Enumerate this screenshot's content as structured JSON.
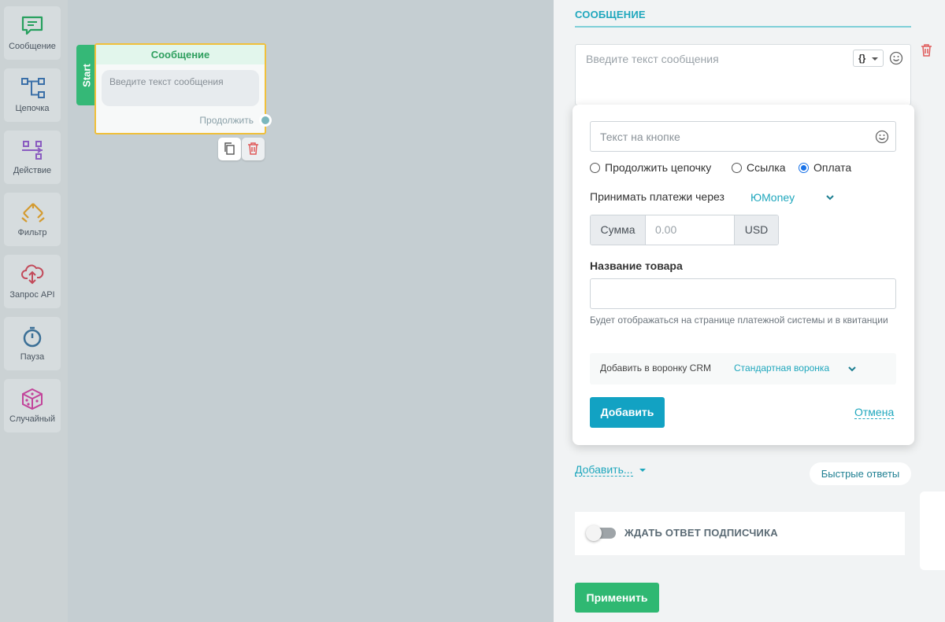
{
  "toolbar": {
    "items": [
      {
        "label": "Сообщение",
        "icon": "message-icon"
      },
      {
        "label": "Цепочка",
        "icon": "chain-icon"
      },
      {
        "label": "Действие",
        "icon": "action-icon"
      },
      {
        "label": "Фильтр",
        "icon": "filter-icon"
      },
      {
        "label": "Запрос API",
        "icon": "api-cloud-icon"
      },
      {
        "label": "Пауза",
        "icon": "timer-icon"
      },
      {
        "label": "Случайный",
        "icon": "dice-icon"
      }
    ]
  },
  "canvas": {
    "start_label": "Start",
    "node": {
      "title": "Сообщение",
      "text_placeholder": "Введите текст сообщения",
      "continue_label": "Продолжить"
    }
  },
  "panel": {
    "title": "СООБЩЕНИЕ",
    "message_placeholder": "Введите текст сообщения",
    "var_button_label": "{}",
    "button_form": {
      "button_text_placeholder": "Текст на кнопке",
      "radio_options": [
        "Продолжить цепочку",
        "Ссылка",
        "Оплата"
      ],
      "radio_selected": "Оплата",
      "pay_via_label": "Принимать платежи через",
      "pay_via_value": "ЮMoney",
      "sum_label": "Сумма",
      "sum_placeholder": "0.00",
      "currency": "USD",
      "product_label": "Название товара",
      "product_help": "Будет отображаться на странице платежной системы и в квитанции",
      "crm_label": "Добавить в воронку CRM",
      "crm_value": "Стандартная воронка",
      "add_button": "Добавить",
      "cancel_link": "Отмена"
    },
    "add_more_label": "Добавить...",
    "quick_replies_label": "Быстрые ответы",
    "wait_reply_label": "ЖДАТЬ ОТВЕТ ПОДПИСЧИКА",
    "wait_reply_on": false,
    "apply_button": "Применить"
  },
  "colors": {
    "accent": "#1fa7bd",
    "green": "#2fb872",
    "primary_button": "#12a2c3",
    "node_border": "#f0c03a",
    "danger": "#e05a5a"
  }
}
